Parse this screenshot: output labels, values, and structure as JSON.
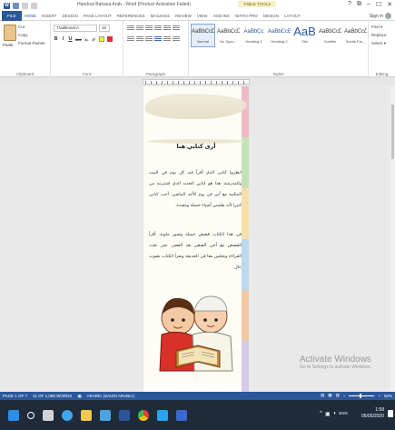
{
  "titlebar": {
    "title": "Handout Bahasa Arab - Word (Product Activation Failed)",
    "tools_tab": "TABLE TOOLS",
    "controls": [
      "?",
      "⧉",
      "–",
      "☐",
      "✕"
    ]
  },
  "tabs": [
    "FILE",
    "HOME",
    "INSERT",
    "DESIGN",
    "PAGE LAYOUT",
    "REFERENCES",
    "MAILINGS",
    "REVIEW",
    "VIEW",
    "ADD-INS",
    "NITRO PRO",
    "DESIGN",
    "LAYOUT"
  ],
  "account": {
    "label": "Sign in"
  },
  "ribbon": {
    "clipboard": {
      "paste": "Paste",
      "cut": "Cut",
      "copy": "Copy",
      "format_painter": "Format Painter",
      "label": "Clipboard"
    },
    "font": {
      "name": "Traditional A",
      "size": "16",
      "row": [
        "B",
        "I",
        "U",
        "abc",
        "x₂",
        "x²",
        "A"
      ],
      "label": "Font"
    },
    "paragraph": {
      "label": "Paragraph"
    },
    "styles": {
      "items": [
        {
          "preview": "AaBbCcDd",
          "name": "Normal"
        },
        {
          "preview": "AaBbCcDd",
          "name": "No Spac..."
        },
        {
          "preview": "AaBbCc",
          "name": "Heading 1"
        },
        {
          "preview": "AaBbCcE",
          "name": "Heading 2"
        },
        {
          "preview": "AaB",
          "name": "Title"
        },
        {
          "preview": "AaBbCcD",
          "name": "Subtitle"
        },
        {
          "preview": "AaBbCcDa",
          "name": "Subtle Em..."
        }
      ],
      "label": "Styles"
    },
    "editing": {
      "find": "Find ▾",
      "replace": "Replace",
      "select": "Select ▾",
      "label": "Editing"
    }
  },
  "document": {
    "heading": "أرى كتابي هنا",
    "para1": "انظروا كتابي الذي أقرأ فيه كل يوم في البيت والمدرسة. هذا هو كتابي الجديد الذي اشتريته من المكتبة مع أبي في يوم الأحد الماضي. أحب كتابي كثيرا لأنه يعلمني أشياء جميلة ومفيدة.",
    "para2": "في هذا الكتاب قصص جميلة وصور ملونة. أقرأ القصص مع أخي الصغير بعد العصر. نحن نحب القراءة ونجلس معا في الحديقة ونقرأ الكتاب بصوت عال."
  },
  "status": {
    "page": "PAGE 1 OF 7",
    "words": "11 OF 1,085 WORDS",
    "language": "ARABIC (SAUDI ARABIA)",
    "zoom": "60%"
  },
  "taskbar": {
    "time": "1:58",
    "date": "05/05/2020",
    "tray_icons": [
      "^",
      "▣",
      "◖",
      "ENG"
    ]
  },
  "watermark": {
    "title": "Activate Windows",
    "subtitle": "Go to Settings to activate Windows."
  },
  "colors": {
    "accent": "#2b579a",
    "taskbar": "#1f2b3b",
    "page_bands": [
      "#f0b9c4",
      "#c3e3b4",
      "#f6e0a6",
      "#bcd9ef",
      "#f4c8a0",
      "#d7c9ea"
    ]
  }
}
